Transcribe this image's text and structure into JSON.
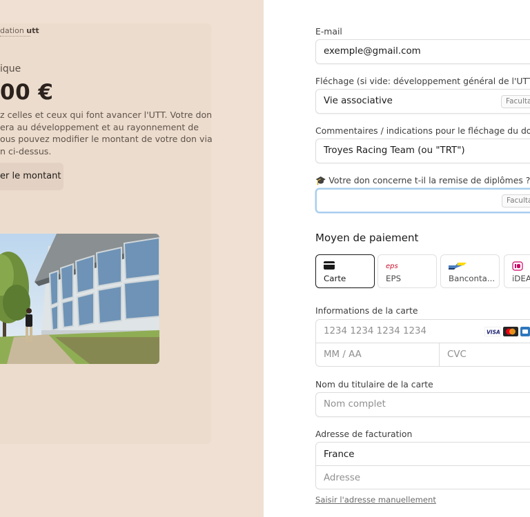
{
  "left": {
    "brand_prefix": "dation ",
    "brand_name": "utt",
    "amount_label": "ique",
    "amount": "00 €",
    "description_lines": [
      "z celles et ceux qui font avancer l'UTT. Votre don",
      "era au développement et au rayonnement de",
      "ous pouvez modifier le montant de votre don via",
      "n ci-dessus."
    ],
    "modify_button": "er le montant"
  },
  "form": {
    "email": {
      "label": "E-mail",
      "value": "exemple@gmail.com"
    },
    "flechage": {
      "label": "Fléchage (si vide: développement général de l'UTT)",
      "value": "Vie associative",
      "badge": "Faculta"
    },
    "commentaires": {
      "label": "Commentaires / indications pour le fléchage du don",
      "value": "Troyes Racing Team (ou \"TRT\")"
    },
    "diplomes": {
      "label": "🎓 Votre don concerne t-il la remise de diplômes ?",
      "value": "",
      "badge": "Faculta"
    }
  },
  "payment": {
    "section_title": "Moyen de paiement",
    "methods": [
      {
        "label": "Carte",
        "icon": "credit-card-icon",
        "selected": true
      },
      {
        "label": "EPS",
        "icon": "eps-icon",
        "selected": false
      },
      {
        "label": "Banconta...",
        "icon": "bancontact-icon",
        "selected": false
      },
      {
        "label": "iDEA",
        "icon": "ideal-icon",
        "selected": false
      }
    ],
    "card_info_label": "Informations de la carte",
    "card_number_placeholder": "1234 1234 1234 1234",
    "expiry_placeholder": "MM / AA",
    "cvc_placeholder": "CVC",
    "card_brands": [
      "VISA",
      "mastercard",
      "amex"
    ],
    "holder_label": "Nom du titulaire de la carte",
    "holder_placeholder": "Nom complet",
    "billing_label": "Adresse de facturation",
    "country": "France",
    "address_placeholder": "Adresse",
    "manual_link": "Saisir l'adresse manuellement"
  },
  "colors": {
    "left_bg": "#efe0d3",
    "focus_ring": "#a7cdee",
    "visa_blue": "#1a1f71",
    "mastercard_red": "#eb001b",
    "mastercard_orange": "#f79e1b"
  }
}
